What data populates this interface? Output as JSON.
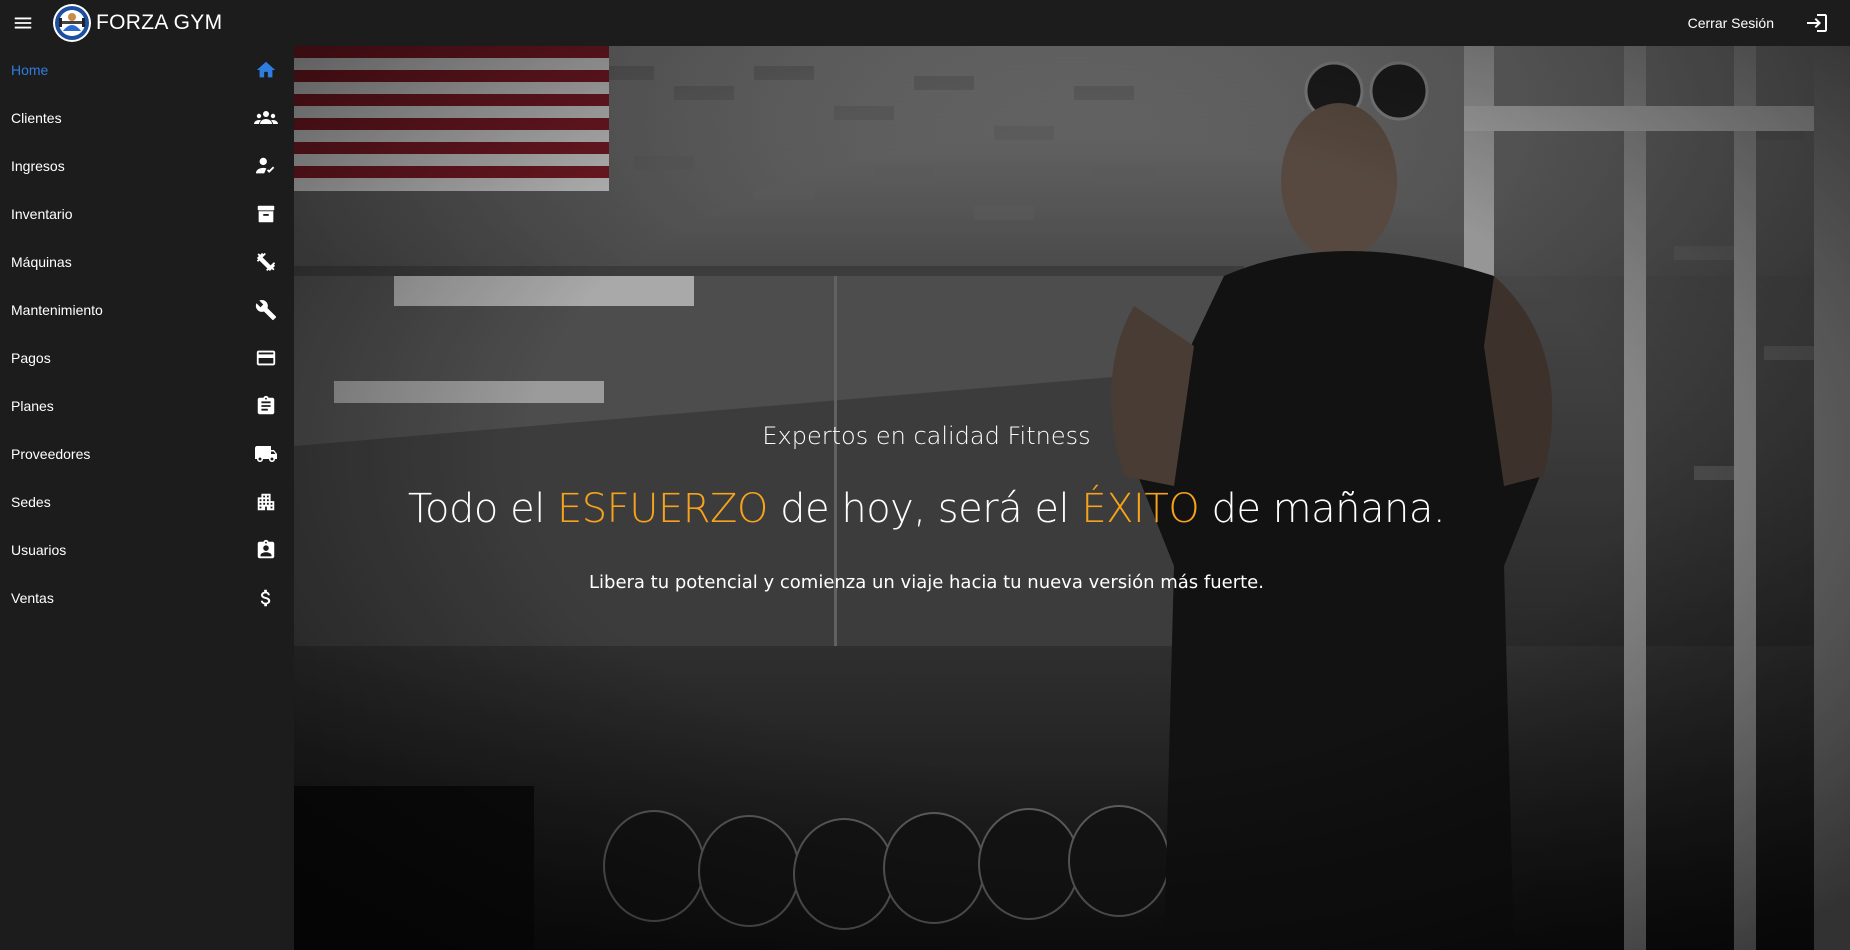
{
  "app": {
    "brand": "FORZA GYM",
    "logout_label": "Cerrar Sesión"
  },
  "sidebar": {
    "items": [
      {
        "label": "Home",
        "icon": "home-icon",
        "active": true
      },
      {
        "label": "Clientes",
        "icon": "groups-icon"
      },
      {
        "label": "Ingresos",
        "icon": "person-check-icon"
      },
      {
        "label": "Inventario",
        "icon": "archive-icon"
      },
      {
        "label": "Máquinas",
        "icon": "dumbbell-icon"
      },
      {
        "label": "Mantenimiento",
        "icon": "wrench-icon"
      },
      {
        "label": "Pagos",
        "icon": "credit-card-icon"
      },
      {
        "label": "Planes",
        "icon": "clipboard-icon"
      },
      {
        "label": "Proveedores",
        "icon": "truck-icon"
      },
      {
        "label": "Sedes",
        "icon": "building-icon"
      },
      {
        "label": "Usuarios",
        "icon": "badge-icon"
      },
      {
        "label": "Ventas",
        "icon": "dollar-icon"
      }
    ]
  },
  "hero": {
    "tagline": "Expertos en calidad Fitness",
    "headline": {
      "part1": "Todo el ",
      "highlight1": "ESFUERZO",
      "part2": " de hoy, será el ",
      "highlight2": "ÉXITO",
      "part3": " de mañana."
    },
    "subtitle": "Libera tu potencial y comienza un viaje hacia tu nueva versión más fuerte."
  },
  "colors": {
    "background": "#1c1c1c",
    "active": "#2f7de1",
    "accent": "#f7a21c"
  }
}
